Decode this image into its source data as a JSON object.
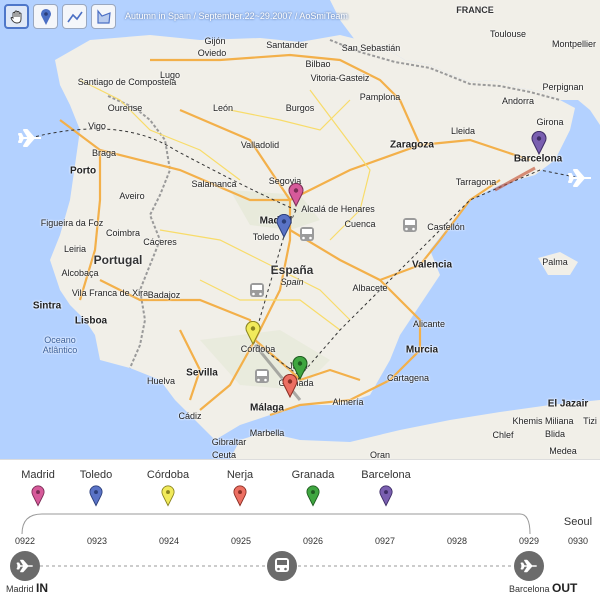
{
  "toolbar": {
    "tools": [
      {
        "icon": "hand-icon",
        "active": true
      },
      {
        "icon": "marker-icon",
        "active": false
      },
      {
        "icon": "polyline-icon",
        "active": false
      },
      {
        "icon": "polygon-icon",
        "active": false
      }
    ]
  },
  "trip_title": "Autumn in Spain / September.22~29.2007 / AoSmiTeam",
  "map": {
    "countries": [
      "España",
      "Portugal",
      "FRANCE"
    ],
    "country_sub": "Spain",
    "seas": [
      "Oceano Atlântico"
    ],
    "cities": [
      "Gijón",
      "Oviedo",
      "Santander",
      "Bilbao",
      "San Sebastián",
      "Toulouse",
      "Montpellier",
      "Perpignan",
      "Andorra",
      "Santiago de Compostela",
      "Lugo",
      "Ourense",
      "León",
      "Burgos",
      "Vitoria-Gasteiz",
      "Pamplona",
      "Vigo",
      "Braga",
      "Porto",
      "Aveiro",
      "Valladolid",
      "Zaragoza",
      "Lleida",
      "Girona",
      "Barcelona",
      "Salamanca",
      "Segovia",
      "Figueira da Foz",
      "Coimbra",
      "Alcalá de Henares",
      "Madrid",
      "Toledo",
      "Tarragona",
      "Leiria",
      "Cáceres",
      "Cuenca",
      "Castellón",
      "Valencia",
      "Palma",
      "Alcobaça",
      "Sintra",
      "Vila Franca de Xira",
      "Lisboa",
      "Badajoz",
      "Albacete",
      "Alicante",
      "Murcia",
      "Cartagena",
      "Córdoba",
      "Jaén",
      "Sevilla",
      "Huelva",
      "Granada",
      "Cádiz",
      "Málaga",
      "Almería",
      "Marbella",
      "Gibraltar",
      "Ceuta",
      "Khemis Miliana",
      "Blida",
      "El Jazair",
      "Chlef",
      "Oran",
      "Tizi",
      "Medea"
    ],
    "route_markers": [
      {
        "name": "Madrid",
        "color": "#d65a9a"
      },
      {
        "name": "Toledo",
        "color": "#5a73c6"
      },
      {
        "name": "Córdoba",
        "color": "#f1ea5b"
      },
      {
        "name": "Nerja",
        "color": "#ec6f62"
      },
      {
        "name": "Granada",
        "color": "#3fa640"
      },
      {
        "name": "Barcelona",
        "color": "#7a5fb0"
      }
    ]
  },
  "timeline": {
    "stops": [
      {
        "city": "Madrid",
        "color": "#d65a9a"
      },
      {
        "city": "Toledo",
        "color": "#5a73c6"
      },
      {
        "city": "Córdoba",
        "color": "#f1ea5b"
      },
      {
        "city": "Nerja",
        "color": "#ec6f62"
      },
      {
        "city": "Granada",
        "color": "#3fa640"
      },
      {
        "city": "Barcelona",
        "color": "#7a5fb0"
      }
    ],
    "dates": [
      "0922",
      "0923",
      "0924",
      "0925",
      "0926",
      "0927",
      "0928",
      "0929",
      "0930"
    ],
    "end_city": "Seoul",
    "start": {
      "city": "Madrid",
      "tag": "IN"
    },
    "end": {
      "city": "Barcelona",
      "tag": "OUT"
    },
    "transport_icon": "bus-icon"
  }
}
